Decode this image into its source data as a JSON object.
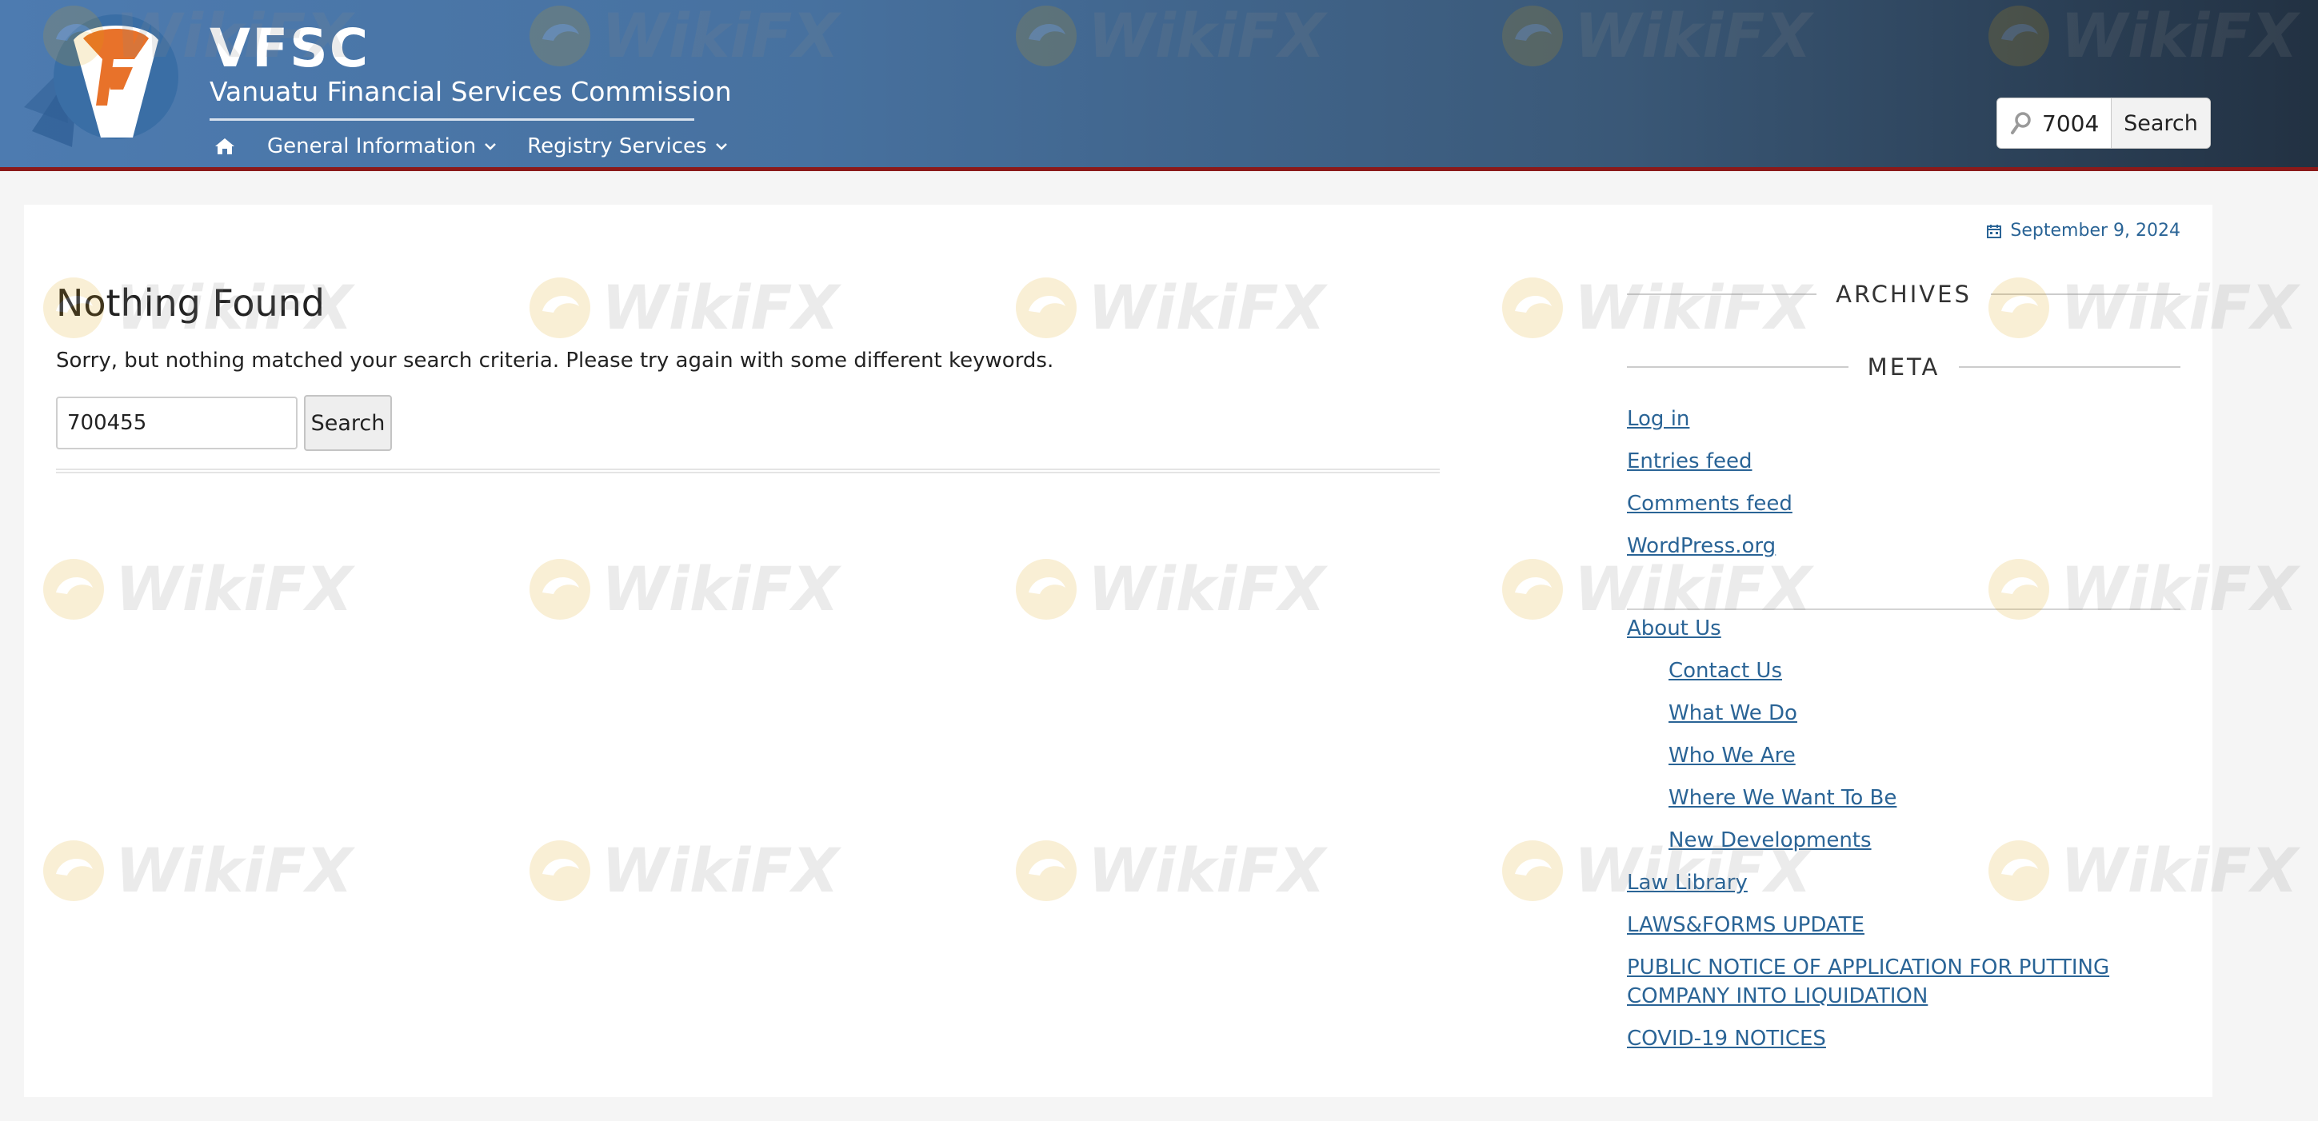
{
  "header": {
    "brand_name": "VFSC",
    "brand_subtitle": "Vanuatu Financial Services Commission",
    "nav": {
      "home_icon": "home-icon",
      "items": [
        {
          "label": "General Information"
        },
        {
          "label": "Registry Services"
        }
      ]
    },
    "search": {
      "value": "7004",
      "button_label": "Search"
    }
  },
  "content": {
    "date": "September 9, 2024",
    "title": "Nothing Found",
    "message": "Sorry, but nothing matched your search criteria. Please try again with some different keywords.",
    "search": {
      "value": "700455",
      "button_label": "Search"
    }
  },
  "sidebar": {
    "archives_title": "ARCHIVES",
    "meta_title": "META",
    "meta_links": [
      "Log in",
      "Entries feed",
      "Comments feed",
      "WordPress.org"
    ],
    "pages": {
      "about": "About Us",
      "about_children": [
        "Contact Us",
        "What We Do",
        "Who We Are",
        "Where We Want To Be",
        "New Developments"
      ],
      "law_library": "Law Library",
      "laws_forms": "LAWS&FORMS UPDATE",
      "public_notice_line1": "PUBLIC NOTICE OF APPLICATION FOR PUTTING",
      "public_notice_line2": "COMPANY INTO LIQUIDATION",
      "covid": "COVID-19 NOTICES"
    }
  },
  "watermark": {
    "text": "WikiFX"
  },
  "colors": {
    "link": "#2a6496",
    "header_start": "#4d7bb0",
    "header_end": "#223142",
    "header_border": "#8b1a1a",
    "logo_orange": "#e8722a",
    "logo_blue": "#3a6ea5"
  }
}
